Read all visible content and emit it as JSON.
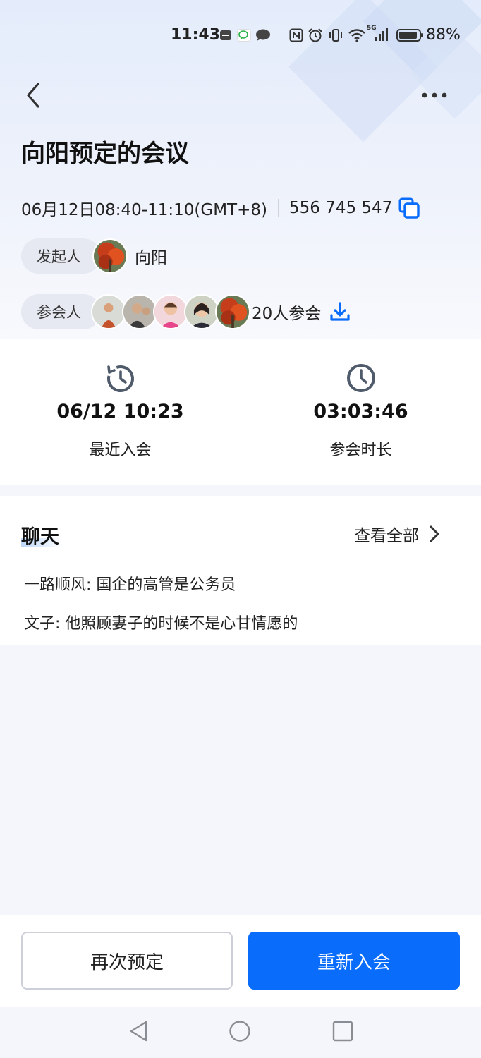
{
  "status_bar": {
    "time": "11:43",
    "network": "5G",
    "battery": "88%",
    "icons": [
      "app-notification-icon",
      "wechat-icon",
      "chat-bubble-icon",
      "nfc-icon",
      "alarm-icon",
      "vibrate-icon",
      "wifi-icon",
      "signal-icon",
      "battery-icon"
    ]
  },
  "header": {
    "back_icon": "chevron-left-icon",
    "more_icon": "more-horizontal-icon"
  },
  "meeting": {
    "title": "向阳预定的会议",
    "time_range": "06月12日08:40-11:10(GMT+8)",
    "meeting_id": "556 745 547",
    "copy_icon": "copy-icon",
    "host_label": "发起人",
    "host_name": "向阳",
    "attendees_label": "参会人",
    "attendee_count": "20人参会",
    "download_icon": "download-icon"
  },
  "stats": {
    "recent_join": {
      "value": "06/12 10:23",
      "label": "最近入会",
      "icon": "history-clock-icon"
    },
    "duration": {
      "value": "03:03:46",
      "label": "参会时长",
      "icon": "clock-icon"
    }
  },
  "chat": {
    "title": "聊天",
    "view_all": "查看全部",
    "messages": [
      {
        "text": "一路顺风: 国企的高管是公务员"
      },
      {
        "text": "文子: 他照顾妻子的时候不是心甘情愿的"
      }
    ]
  },
  "actions": {
    "rebook": "再次预定",
    "rejoin": "重新入会"
  },
  "colors": {
    "accent": "#0a6cfa",
    "background": "#f5f6fb",
    "icon_gray": "#4f5a6b"
  }
}
